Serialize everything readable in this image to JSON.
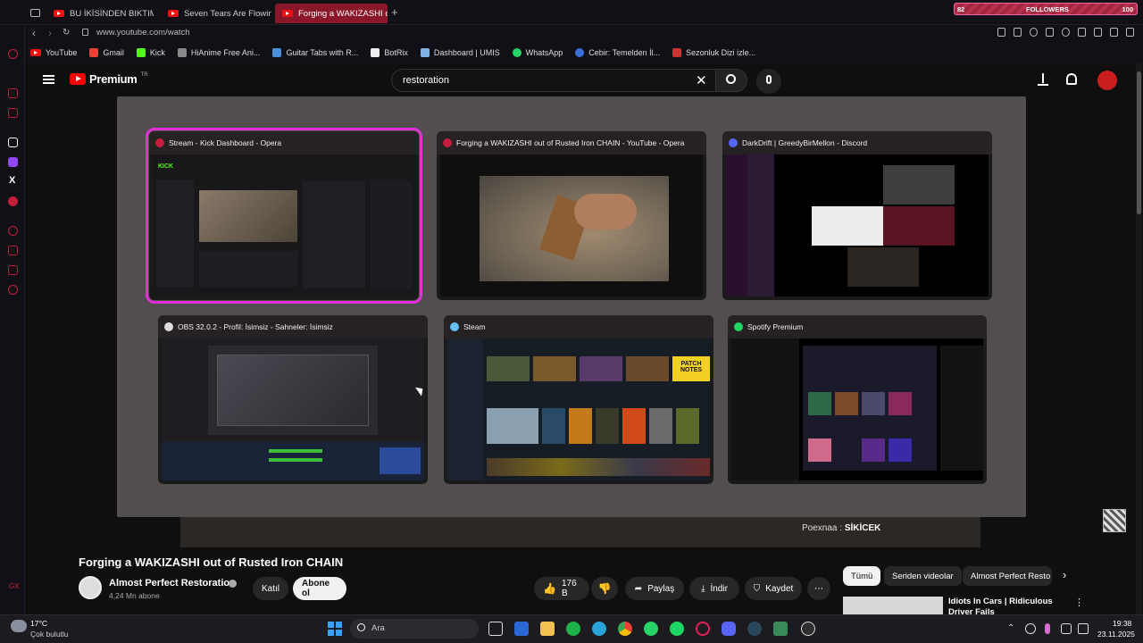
{
  "browser": {
    "tabs": [
      {
        "label": "BU İKİSİNDEN BIKTIM UL..."
      },
      {
        "label": "Seven Tears Are Flowing..."
      },
      {
        "label": "Forging a WAKIZASHI out..."
      }
    ],
    "url": "www.youtube.com/watch",
    "bookmarks": [
      "YouTube",
      "Gmail",
      "Kick",
      "HiAnime Free Ani...",
      "Guitar Tabs with R...",
      "BotRix",
      "Dashboard | UMIS",
      "WhatsApp",
      "Cebir: Temelden İl...",
      "Sezonluk Dizi izle..."
    ],
    "followers_widget": {
      "left": "82",
      "label": "FOLLOWERS",
      "right": "100"
    }
  },
  "youtube": {
    "logo": "Premium",
    "logo_region": "TR",
    "search_value": "restoration",
    "video_title": "Forging a WAKIZASHI out of Rusted Iron CHAIN",
    "channel": {
      "name": "Almost Perfect Restoration",
      "subs": "4,24 Mn abone"
    },
    "join_label": "Katıl",
    "subscribe_label": "Abone ol",
    "likes": "176 B",
    "share_label": "Paylaş",
    "download_label": "İndir",
    "save_label": "Kaydet",
    "chips": [
      "Tümü",
      "Seriden videolar",
      "Almost Perfect Resto"
    ],
    "up_next_title": "Idiots In Cars | Ridiculous Driver Fails",
    "overlay_caption": {
      "prefix": "Poexnaa : ",
      "text": "SİKİCEK"
    }
  },
  "switcher": {
    "windows": [
      {
        "title": "Stream - Kick Dashboard - Opera",
        "selected": true,
        "icon_color": "#c41e3a"
      },
      {
        "title": "Forging a WAKIZASHI out of Rusted Iron CHAIN - YouTube - Opera",
        "selected": false,
        "icon_color": "#c41e3a"
      },
      {
        "title": "DarkDrift | GreedyBirMellon - Discord",
        "selected": false,
        "icon_color": "#5865f2"
      },
      {
        "title": "OBS 32.0.2 - Profil: İsimsiz - Sahneler: İsimsiz",
        "selected": false,
        "icon_color": "#dddddd"
      },
      {
        "title": "Steam",
        "selected": false,
        "icon_color": "#66c0f4"
      },
      {
        "title": "Spotify Premium",
        "selected": false,
        "icon_color": "#1ed760"
      }
    ],
    "steam_banner": "PATCH NOTES",
    "kick_logo": "KICK"
  },
  "taskbar": {
    "weather_temp": "17°C",
    "weather_desc": "Çok bulutlu",
    "search_placeholder": "Ara",
    "time": "19:38",
    "date": "23.11.2025"
  }
}
